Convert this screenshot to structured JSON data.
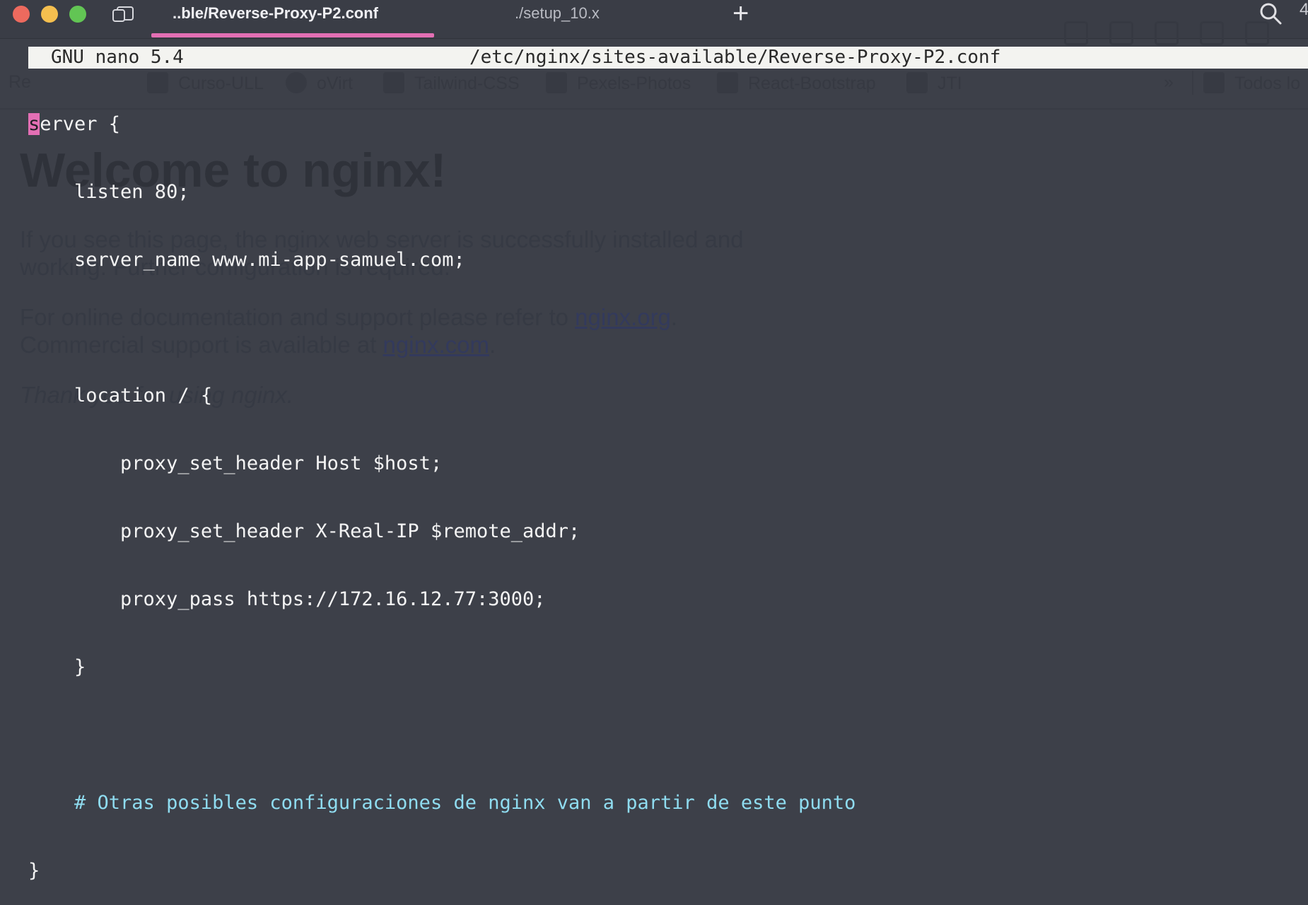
{
  "window": {
    "tabs": [
      {
        "label": "..ble/Reverse-Proxy-P2.conf",
        "active": true
      },
      {
        "label": "./setup_10.x",
        "active": false
      }
    ],
    "new_tab_glyph": "+",
    "overflow_count": "4",
    "accent_color": "#e36fb4"
  },
  "background_page": {
    "bookmarks": [
      "Curso-ULL",
      "oVirt",
      "Tailwind-CSS",
      "Pexels-Photos",
      "React-Bootstrap",
      "JTI",
      "Todos lo"
    ],
    "bookmark_overflow": "»",
    "bookmark_partial": "Re",
    "heading": "Welcome to nginx!",
    "para1_line1": "If you see this page, the nginx web server is successfully installed and",
    "para1_line2": "working. Further configuration is required.",
    "para2_prefix": "For online documentation and support please refer to ",
    "para2_link": "nginx.org",
    "para2_suffix": ".",
    "para3_prefix": "Commercial support is available at ",
    "para3_link": "nginx.com",
    "para3_suffix": ".",
    "thanks": "Thank you for using nginx."
  },
  "nano": {
    "version": "GNU nano 5.4",
    "file_path": "/etc/nginx/sites-available/Reverse-Proxy-P2.conf",
    "cursor_char": "s",
    "lines": [
      "erver {",
      "    listen 80;",
      "    server_name www.mi-app-samuel.com;",
      "",
      "    location / {",
      "        proxy_set_header Host $host;",
      "        proxy_set_header X-Real-IP $remote_addr;",
      "        proxy_pass https://172.16.12.77:3000;",
      "    }",
      "",
      "    # Otras posibles configuraciones de nginx van a partir de este punto",
      "}"
    ]
  }
}
